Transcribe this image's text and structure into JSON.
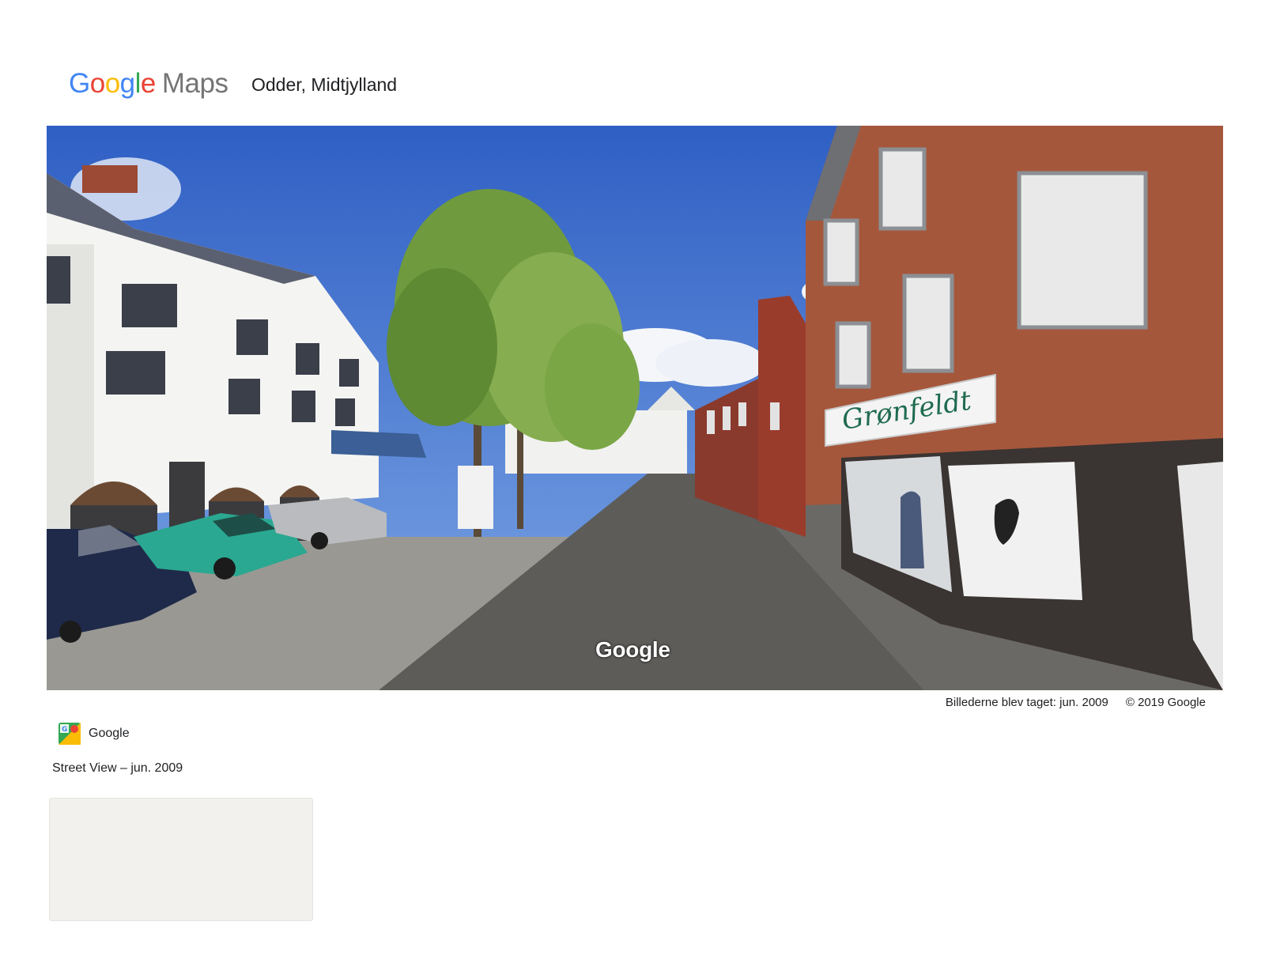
{
  "header": {
    "logo": {
      "text": "Google Maps",
      "google": [
        "G",
        "o",
        "o",
        "g",
        "l",
        "e"
      ],
      "maps": "Maps"
    },
    "place_title": "Odder, Midtjylland"
  },
  "panorama": {
    "watermark": "Google",
    "storefront_sign": "Grønfeldt"
  },
  "attribution": {
    "capture_date": "Billederne blev taget: jun. 2009",
    "copyright": "© 2019 Google"
  },
  "contributor": {
    "icon": "street-view-photo-icon",
    "name": "Google"
  },
  "caption": "Street View – jun. 2009",
  "colors": {
    "google_blue": "#4285f4",
    "google_red": "#ea4335",
    "google_yellow": "#fbbc05",
    "google_green": "#34a853",
    "maps_gray": "#757575"
  }
}
